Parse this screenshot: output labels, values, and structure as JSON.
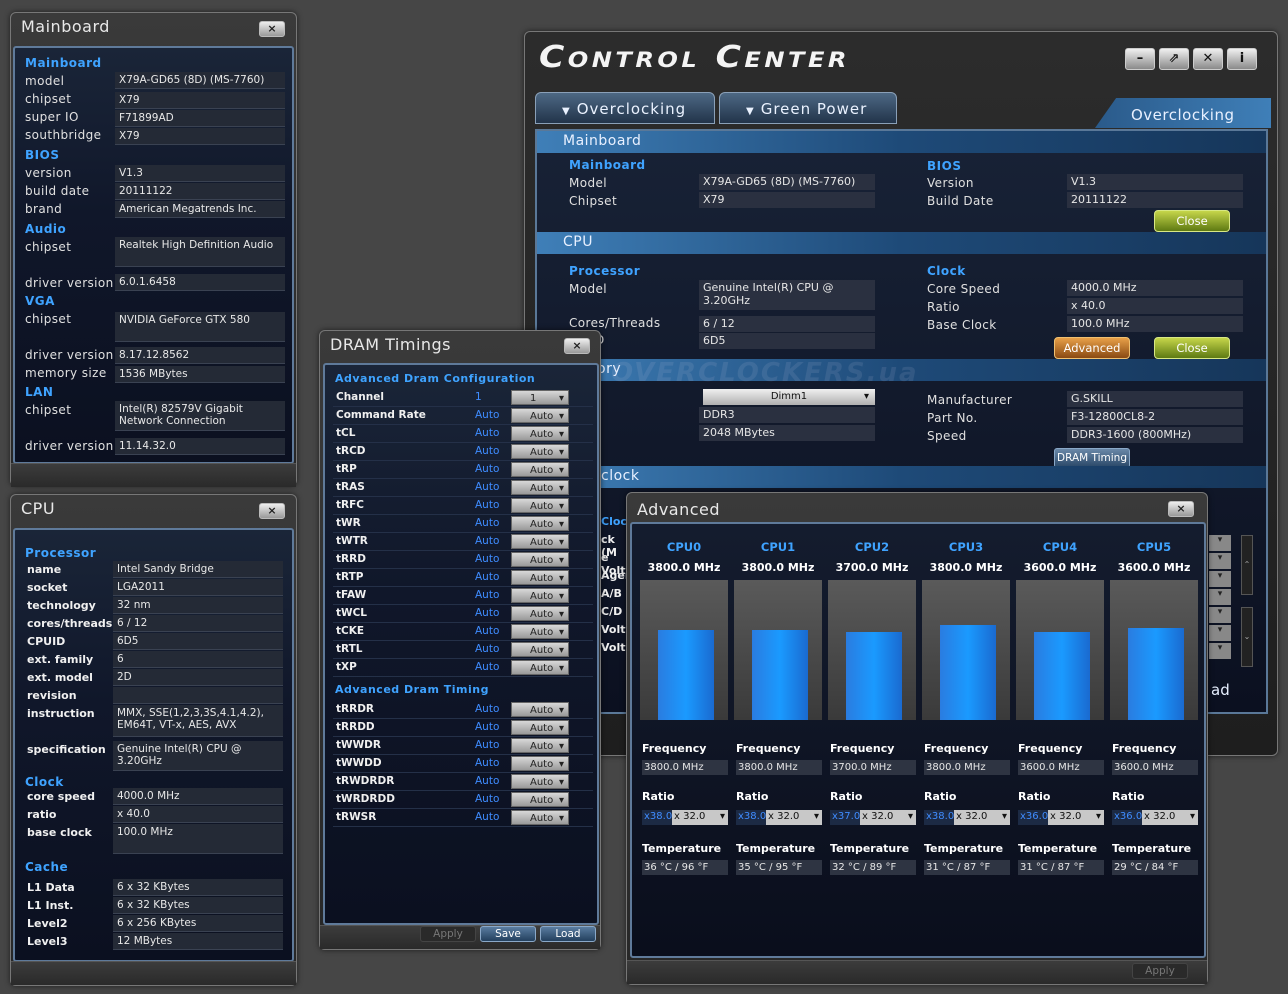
{
  "mainboard_win": {
    "title": "Mainboard",
    "close": "×",
    "sections": {
      "mainboard": "Mainboard",
      "bios": "BIOS",
      "audio": "Audio",
      "vga": "VGA",
      "lan": "LAN"
    },
    "model_l": "model",
    "model": "X79A-GD65 (8D) (MS-7760)",
    "chipset_l": "chipset",
    "chipset": "X79",
    "superio_l": "super IO",
    "superio": "F71899AD",
    "south_l": "southbridge",
    "south": "X79",
    "version_l": "version",
    "version": "V1.3",
    "build_l": "build date",
    "build": "20111122",
    "brand_l": "brand",
    "brand": "American Megatrends Inc.",
    "audio_chip_l": "chipset",
    "audio_chip": "Realtek High Definition Audio",
    "audio_drv_l": "driver version",
    "audio_drv": "6.0.1.6458",
    "vga_chip_l": "chipset",
    "vga_chip": "NVIDIA GeForce GTX 580",
    "vga_drv_l": "driver version",
    "vga_drv": "8.17.12.8562",
    "vga_mem_l": "memory size",
    "vga_mem": "1536 MBytes",
    "lan_chip_l": "chipset",
    "lan_chip": "Intel(R) 82579V Gigabit Network Connection",
    "lan_drv_l": "driver version",
    "lan_drv": "11.14.32.0"
  },
  "cpu_win": {
    "title": "CPU",
    "close": "×",
    "processor": "Processor",
    "clock": "Clock",
    "cache": "Cache",
    "rows": [
      {
        "l": "name",
        "v": "Intel Sandy Bridge"
      },
      {
        "l": "socket",
        "v": "LGA2011"
      },
      {
        "l": "technology",
        "v": "32 nm"
      },
      {
        "l": "cores/threads",
        "v": "6 / 12"
      },
      {
        "l": "CPUID",
        "v": "6D5"
      },
      {
        "l": "ext. family",
        "v": "6"
      },
      {
        "l": "ext. model",
        "v": "2D"
      },
      {
        "l": "revision",
        "v": ""
      },
      {
        "l": "instruction",
        "v": "MMX, SSE(1,2,3,3S,4.1,4.2), EM64T, VT-x, AES, AVX"
      },
      {
        "l": "specification",
        "v": "Genuine Intel(R) CPU  @ 3.20GHz"
      }
    ],
    "clock_rows": [
      {
        "l": "core speed",
        "v": "4000.0 MHz"
      },
      {
        "l": "ratio",
        "v": "x 40.0"
      },
      {
        "l": "base clock",
        "v": "100.0 MHz"
      }
    ],
    "cache_rows": [
      {
        "l": "L1 Data",
        "v": "6 x 32 KBytes"
      },
      {
        "l": "L1 Inst.",
        "v": "6 x 32 KBytes"
      },
      {
        "l": "Level2",
        "v": "6 x 256 KBytes"
      },
      {
        "l": "Level3",
        "v": "12 MBytes"
      }
    ]
  },
  "dram_win": {
    "title": "DRAM Timings",
    "close": "×",
    "adv_config": "Advanced Dram Configuration",
    "adv_timing": "Advanced Dram Timing",
    "rows": [
      {
        "n": "Channel",
        "a": "1",
        "s": "1"
      },
      {
        "n": "Command Rate",
        "a": "Auto",
        "s": "Auto"
      },
      {
        "n": "tCL",
        "a": "Auto",
        "s": "Auto"
      },
      {
        "n": "tRCD",
        "a": "Auto",
        "s": "Auto"
      },
      {
        "n": "tRP",
        "a": "Auto",
        "s": "Auto"
      },
      {
        "n": "tRAS",
        "a": "Auto",
        "s": "Auto"
      },
      {
        "n": "tRFC",
        "a": "Auto",
        "s": "Auto"
      },
      {
        "n": "tWR",
        "a": "Auto",
        "s": "Auto"
      },
      {
        "n": "tWTR",
        "a": "Auto",
        "s": "Auto"
      },
      {
        "n": "tRRD",
        "a": "Auto",
        "s": "Auto"
      },
      {
        "n": "tRTP",
        "a": "Auto",
        "s": "Auto"
      },
      {
        "n": "tFAW",
        "a": "Auto",
        "s": "Auto"
      },
      {
        "n": "tWCL",
        "a": "Auto",
        "s": "Auto"
      },
      {
        "n": "tCKE",
        "a": "Auto",
        "s": "Auto"
      },
      {
        "n": "tRTL",
        "a": "Auto",
        "s": "Auto"
      },
      {
        "n": "tXP",
        "a": "Auto",
        "s": "Auto"
      }
    ],
    "rows2": [
      {
        "n": "tRRDR",
        "a": "Auto",
        "s": "Auto"
      },
      {
        "n": "tRRDD",
        "a": "Auto",
        "s": "Auto"
      },
      {
        "n": "tWWDR",
        "a": "Auto",
        "s": "Auto"
      },
      {
        "n": "tWWDD",
        "a": "Auto",
        "s": "Auto"
      },
      {
        "n": "tRWDRDR",
        "a": "Auto",
        "s": "Auto"
      },
      {
        "n": "tWRDRDD",
        "a": "Auto",
        "s": "Auto"
      },
      {
        "n": "tRWSR",
        "a": "Auto",
        "s": "Auto"
      }
    ],
    "apply": "Apply",
    "save": "Save",
    "load": "Load"
  },
  "cc": {
    "title": "Control Center",
    "tab1": "Overclocking",
    "tab2": "Green Power",
    "header_right": "Overclocking",
    "band_mainboard": "Mainboard",
    "band_cpu": "CPU",
    "mb": "Mainboard",
    "mb_model_l": "Model",
    "mb_model": "X79A-GD65 (8D) (MS-7760)",
    "mb_chip_l": "Chipset",
    "mb_chip": "X79",
    "bios": "BIOS",
    "bios_ver_l": "Version",
    "bios_ver": "V1.3",
    "bios_build_l": "Build Date",
    "bios_build": "20111122",
    "close": "Close",
    "proc": "Processor",
    "proc_model_l": "Model",
    "proc_model": "Genuine Intel(R) CPU  @ 3.20GHz",
    "proc_ct_l": "Cores/Threads",
    "proc_ct": "6 / 12",
    "proc_id_l": "D",
    "proc_id": "6D5",
    "clock": "Clock",
    "core_l": "Core Speed",
    "core": "4000.0 MHz",
    "ratio_l": "Ratio",
    "ratio": "x 40.0",
    "base_l": "Base Clock",
    "base": "100.0 MHz",
    "advanced": "Advanced",
    "close2": "Close",
    "memory_partial": "ory",
    "dimm": "Dimm1",
    "mem_type": "DDR3",
    "mem_size": "2048 MBytes",
    "manu_l": "Manufacturer",
    "manu": "G.SKILL",
    "part_l": "Part No.",
    "part": "F3-12800CL8-2",
    "speed_l": "Speed",
    "speed": "DDR3-1600 (800MHz)",
    "dram_timing": "DRAM Timing",
    "clock_partial": "clock",
    "side_labels": [
      "Cloc",
      "ck (M",
      "e Volt",
      "Agen",
      "A/B",
      "C/D",
      "Volta",
      "Volta"
    ],
    "ad_partial": "ad",
    "watermark": "OVERCLOCKERS.ua"
  },
  "adv": {
    "title": "Advanced",
    "close": "×",
    "apply": "Apply",
    "freq_l": "Frequency",
    "ratio_l": "Ratio",
    "temp_l": "Temperature",
    "cpus": [
      {
        "name": "CPU0",
        "mhz": "3800.0 MHz",
        "freq": "3800.0 MHz",
        "rcur": "x38.0",
        "rsel": "x 32.0",
        "temp": "36 °C / 96 °F",
        "level": 0.82
      },
      {
        "name": "CPU1",
        "mhz": "3800.0 MHz",
        "freq": "3800.0 MHz",
        "rcur": "x38.0",
        "rsel": "x 32.0",
        "temp": "35 °C / 95 °F",
        "level": 0.82
      },
      {
        "name": "CPU2",
        "mhz": "3700.0 MHz",
        "freq": "3700.0 MHz",
        "rcur": "x37.0",
        "rsel": "x 32.0",
        "temp": "32 °C / 89 °F",
        "level": 0.8
      },
      {
        "name": "CPU3",
        "mhz": "3800.0 MHz",
        "freq": "3800.0 MHz",
        "rcur": "x38.0",
        "rsel": "x 32.0",
        "temp": "31 °C / 87 °F",
        "level": 0.86
      },
      {
        "name": "CPU4",
        "mhz": "3600.0 MHz",
        "freq": "3600.0 MHz",
        "rcur": "x36.0",
        "rsel": "x 32.0",
        "temp": "31 °C / 87 °F",
        "level": 0.8
      },
      {
        "name": "CPU5",
        "mhz": "3600.0 MHz",
        "freq": "3600.0 MHz",
        "rcur": "x36.0",
        "rsel": "x 32.0",
        "temp": "29 °C / 84 °F",
        "level": 0.84
      }
    ]
  },
  "colors": {
    "accent": "#3fa3ff",
    "bar": "#1a8cff"
  }
}
